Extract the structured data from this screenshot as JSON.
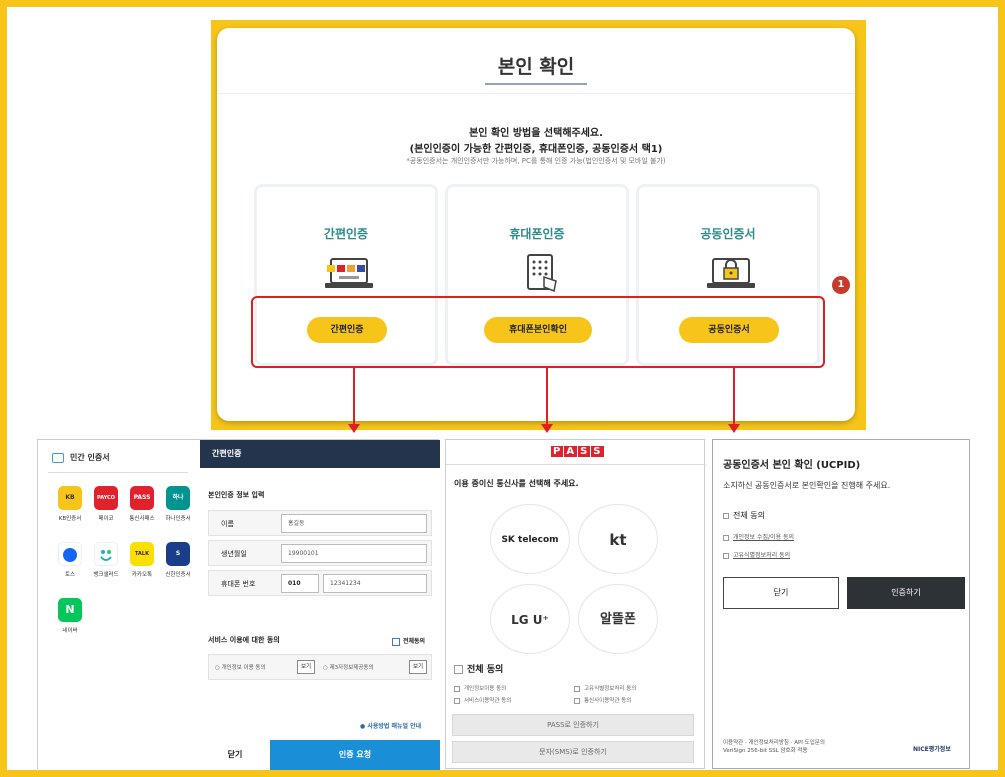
{
  "colors": {
    "accent": "#f7c51a",
    "navy": "#24344d",
    "blue": "#1a8fd8",
    "red": "#e02020",
    "teal": "#2c8b8a"
  },
  "top": {
    "title": "본인 확인",
    "desc1": "본인 확인 방법을 선택해주세요.",
    "desc2": "(본인인증이 가능한 간편인증, 휴대폰인증, 공동인증서 택1)",
    "note": "*공동인증서는 개인인증서만 가능하며, PC를 통해 인증 가능(법인인증서 및 모바일 불가)",
    "badge": "1",
    "options": [
      {
        "label": "간편인증",
        "button": "간편인증",
        "icon": "simple-auth-laptop-icon"
      },
      {
        "label": "휴대폰인증",
        "button": "휴대폰본인확인",
        "icon": "phone-keypad-icon"
      },
      {
        "label": "공동인증서",
        "button": "공동인증서",
        "icon": "lock-laptop-icon"
      }
    ]
  },
  "panel1": {
    "header": "민간 인증서",
    "apps": [
      {
        "name": "KB인증서",
        "abbr": "KB"
      },
      {
        "name": "페이코",
        "abbr": "PAYCO"
      },
      {
        "name": "통신사패스",
        "abbr": "PASS"
      },
      {
        "name": "하나인증서",
        "abbr": "하나"
      },
      {
        "name": "토스",
        "abbr": ""
      },
      {
        "name": "뱅크샐러드",
        "abbr": ""
      },
      {
        "name": "카카오톡",
        "abbr": "TALK"
      },
      {
        "name": "신한인증서",
        "abbr": "S"
      },
      {
        "name": "네이버",
        "abbr": "N"
      }
    ],
    "nav_title": "간편인증",
    "section_title": "본인인증 정보 입력",
    "fields": {
      "name_label": "이름",
      "name_placeholder": "홍길동",
      "birth_label": "생년월일",
      "birth_placeholder": "19900101",
      "phone_label": "휴대폰 번호",
      "phone_prefix": "010",
      "phone_placeholder": "12341234"
    },
    "agree_title": "서비스 이용에 대한 동의",
    "agree_all": "전체동의",
    "agree_items": [
      "개인정보 이용 동의",
      "제3자정보제공동의"
    ],
    "view": "보기",
    "guide": "사용방법 매뉴얼 안내",
    "close": "닫기",
    "request": "인증 요청"
  },
  "panel2": {
    "logo": [
      "P",
      "A",
      "S",
      "S"
    ],
    "question": "이용 중이신 통신사를 선택해 주세요.",
    "carriers": [
      "SK telecom",
      "kt",
      "LG U⁺",
      "알뜰폰"
    ],
    "all_agree": "전체 동의",
    "opts": [
      "개인정보이용 동의",
      "고유식별정보처리 동의",
      "서비스이용약관 동의",
      "통신사이용약관 동의"
    ],
    "btn_pass": "PASS로 인증하기",
    "btn_sms": "문자(SMS)로 인증하기"
  },
  "panel3": {
    "title": "공동인증서 본인 확인 (UCPID)",
    "desc": "소지하신 공동인증서로 본인확인을 진행해 주세요.",
    "all_agree": "전체 동의",
    "opts": [
      "개인정보 수집/이용 동의",
      "고유식별정보처리 동의"
    ],
    "close": "닫기",
    "auth": "인증하기",
    "footer1": "이용약관 · 개인정보처리방침 · API 도입문의",
    "footer2": "VeriSign 256-bit SSL 암호화 적용",
    "nice": "NICE평가정보"
  }
}
